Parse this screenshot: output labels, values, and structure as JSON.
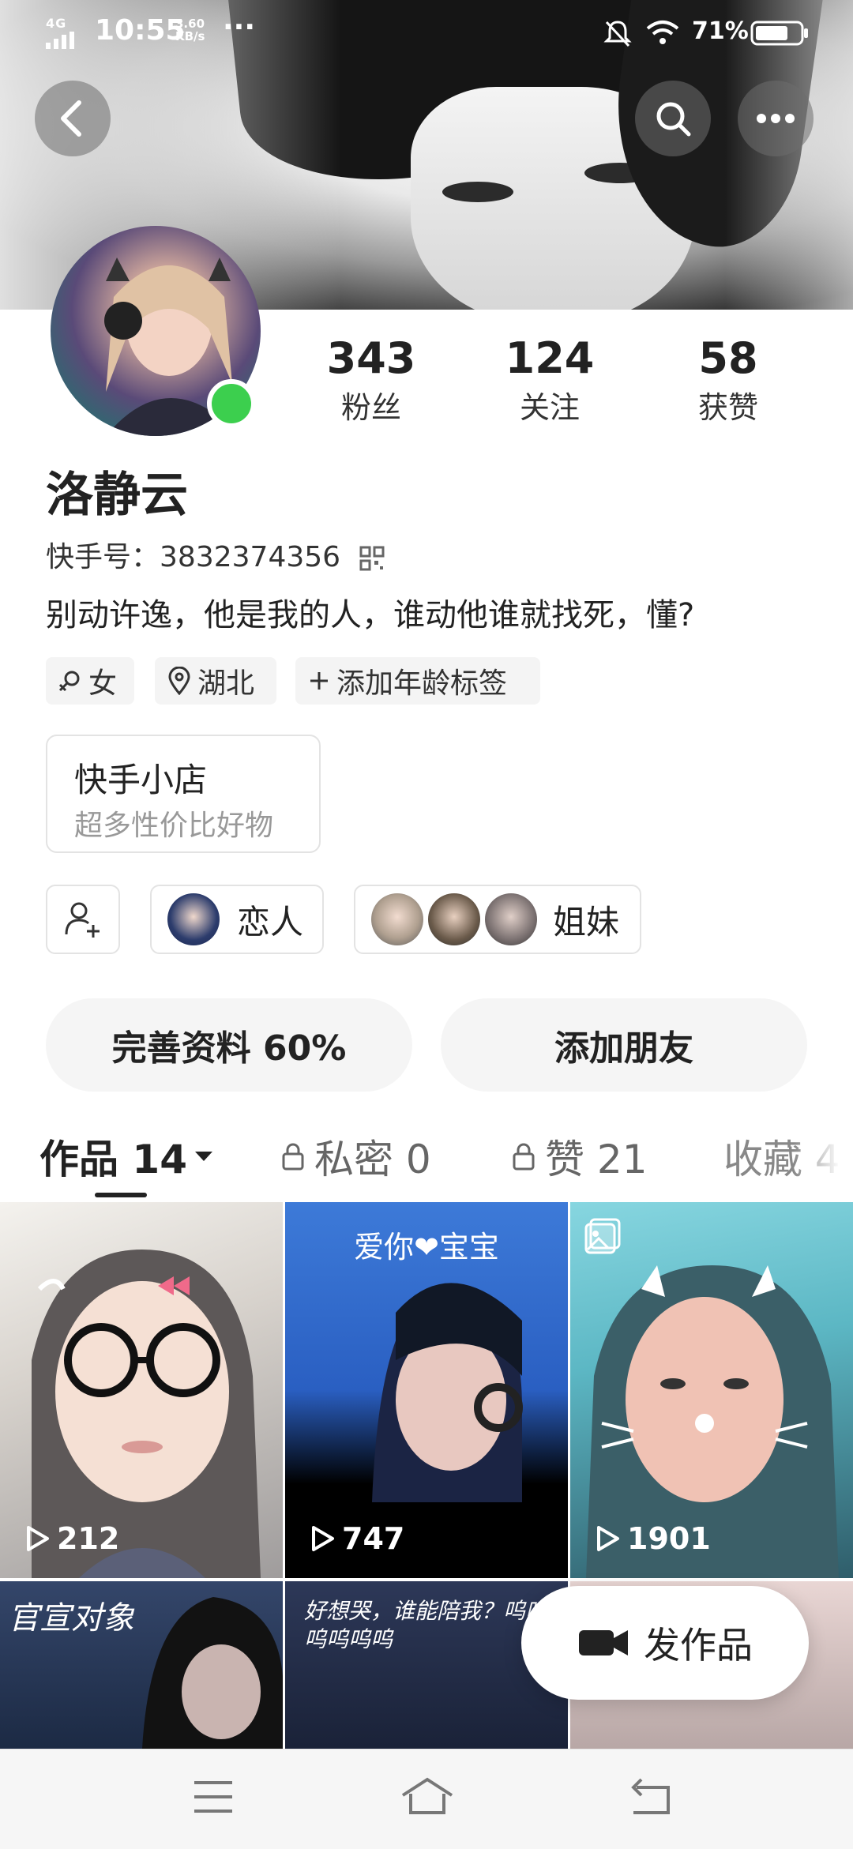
{
  "status_bar": {
    "network": "4G",
    "time": "10:55",
    "speed_value": "3.60",
    "speed_unit": "KB/s",
    "more": "···",
    "battery": "71%"
  },
  "profile": {
    "name": "洛静云",
    "kuaishou_id_label": "快手号：",
    "kuaishou_id": "3832374356",
    "bio": "别动许逸，他是我的人，谁动他谁就找死，懂?",
    "stats": [
      {
        "value": "343",
        "label": "粉丝"
      },
      {
        "value": "124",
        "label": "关注"
      },
      {
        "value": "58",
        "label": "获赞"
      }
    ],
    "tags": [
      {
        "icon": "female-icon",
        "label": "女"
      },
      {
        "icon": "location-icon",
        "label": "湖北"
      },
      {
        "icon": "plus-icon",
        "label": "添加年龄标签"
      }
    ],
    "online_color": "#3ccf4e"
  },
  "shop": {
    "title": "快手小店",
    "subtitle": "超多性价比好物"
  },
  "relations": [
    {
      "label": "恋人"
    },
    {
      "label": "姐妹"
    }
  ],
  "actions": {
    "complete_profile": "完善资料 60%",
    "add_friend": "添加朋友"
  },
  "tabs": [
    {
      "label": "作品 14",
      "active": true
    },
    {
      "label": "私密 0",
      "locked": true
    },
    {
      "label": "赞 21",
      "locked": true
    },
    {
      "label": "收藏 4"
    }
  ],
  "posts": [
    {
      "plays": "212"
    },
    {
      "plays": "747",
      "overlay_title": "爱你❤宝宝"
    },
    {
      "plays": "1901"
    },
    {
      "overlay_text": "官宣对象"
    },
    {
      "overlay_text": "好想哭，谁能陪我？呜呜呜呜呜呜"
    },
    {}
  ],
  "fab": {
    "label": "发作品"
  }
}
